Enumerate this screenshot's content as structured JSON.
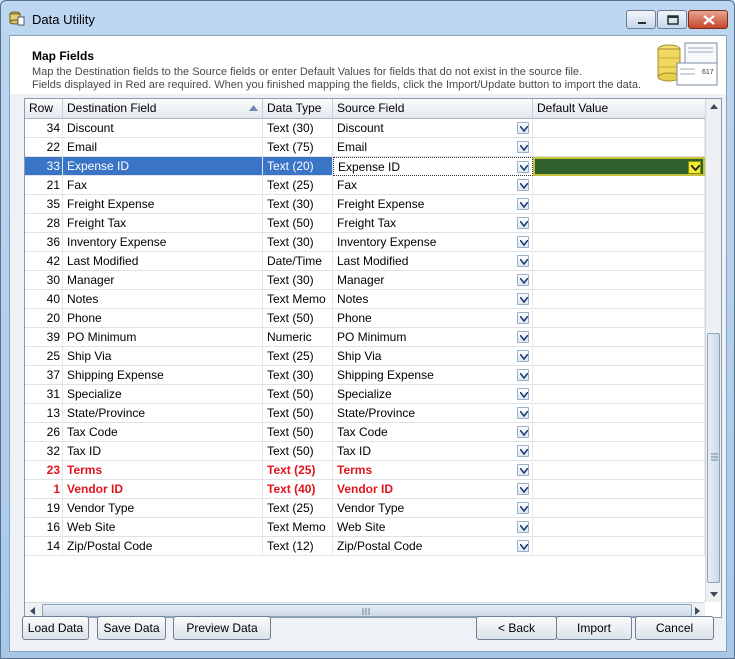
{
  "window": {
    "title": "Data Utility"
  },
  "header": {
    "title": "Map Fields",
    "line1": "Map the Destination fields to the Source fields or enter Default Values for fields that do not exist in the source file.",
    "line2": "Fields displayed in Red are required.  When you finished mapping the fields, click the Import/Update button to import the data.",
    "graphic_number": "617"
  },
  "grid": {
    "columns": {
      "row": "Row",
      "dest": "Destination Field",
      "type": "Data Type",
      "src": "Source Field",
      "def": "Default Value"
    },
    "rows": [
      {
        "row": "34",
        "dest": "Discount",
        "type": "Text (30)",
        "src": "Discount",
        "def": ""
      },
      {
        "row": "22",
        "dest": "Email",
        "type": "Text (75)",
        "src": "Email",
        "def": ""
      },
      {
        "row": "33",
        "dest": "Expense ID",
        "type": "Text (20)",
        "src": "Expense ID",
        "def": "",
        "selected": true
      },
      {
        "row": "21",
        "dest": "Fax",
        "type": "Text (25)",
        "src": "Fax",
        "def": ""
      },
      {
        "row": "35",
        "dest": "Freight Expense",
        "type": "Text (30)",
        "src": "Freight Expense",
        "def": ""
      },
      {
        "row": "28",
        "dest": "Freight Tax",
        "type": "Text (50)",
        "src": "Freight Tax",
        "def": ""
      },
      {
        "row": "36",
        "dest": "Inventory Expense",
        "type": "Text (30)",
        "src": "Inventory Expense",
        "def": ""
      },
      {
        "row": "42",
        "dest": "Last Modified",
        "type": "Date/Time",
        "src": "Last Modified",
        "def": ""
      },
      {
        "row": "30",
        "dest": "Manager",
        "type": "Text (30)",
        "src": "Manager",
        "def": ""
      },
      {
        "row": "40",
        "dest": "Notes",
        "type": "Text Memo",
        "src": "Notes",
        "def": ""
      },
      {
        "row": "20",
        "dest": "Phone",
        "type": "Text (50)",
        "src": "Phone",
        "def": ""
      },
      {
        "row": "39",
        "dest": "PO Minimum",
        "type": "Numeric",
        "src": "PO Minimum",
        "def": ""
      },
      {
        "row": "25",
        "dest": "Ship Via",
        "type": "Text (25)",
        "src": "Ship Via",
        "def": ""
      },
      {
        "row": "37",
        "dest": "Shipping Expense",
        "type": "Text (30)",
        "src": "Shipping Expense",
        "def": ""
      },
      {
        "row": "31",
        "dest": "Specialize",
        "type": "Text (50)",
        "src": "Specialize",
        "def": ""
      },
      {
        "row": "13",
        "dest": "State/Province",
        "type": "Text (50)",
        "src": "State/Province",
        "def": ""
      },
      {
        "row": "26",
        "dest": "Tax Code",
        "type": "Text (50)",
        "src": "Tax Code",
        "def": ""
      },
      {
        "row": "32",
        "dest": "Tax ID",
        "type": "Text (50)",
        "src": "Tax ID",
        "def": ""
      },
      {
        "row": "23",
        "dest": "Terms",
        "type": "Text (25)",
        "src": "Terms",
        "def": "",
        "required": true
      },
      {
        "row": "1",
        "dest": "Vendor ID",
        "type": "Text (40)",
        "src": "Vendor ID",
        "def": "",
        "required": true
      },
      {
        "row": "19",
        "dest": "Vendor Type",
        "type": "Text (25)",
        "src": "Vendor Type",
        "def": ""
      },
      {
        "row": "16",
        "dest": "Web Site",
        "type": "Text Memo",
        "src": "Web Site",
        "def": ""
      },
      {
        "row": "14",
        "dest": "Zip/Postal Code",
        "type": "Text (12)",
        "src": "Zip/Postal Code",
        "def": ""
      }
    ]
  },
  "buttons": {
    "load": "Load Data",
    "save": "Save Data",
    "preview": "Preview Data",
    "back": "< Back",
    "import": "Import",
    "cancel": "Cancel"
  },
  "colors": {
    "selected_row": "#3a74c6",
    "required_text": "#e0141e",
    "default_cell_selected": "#2f5f2a"
  }
}
